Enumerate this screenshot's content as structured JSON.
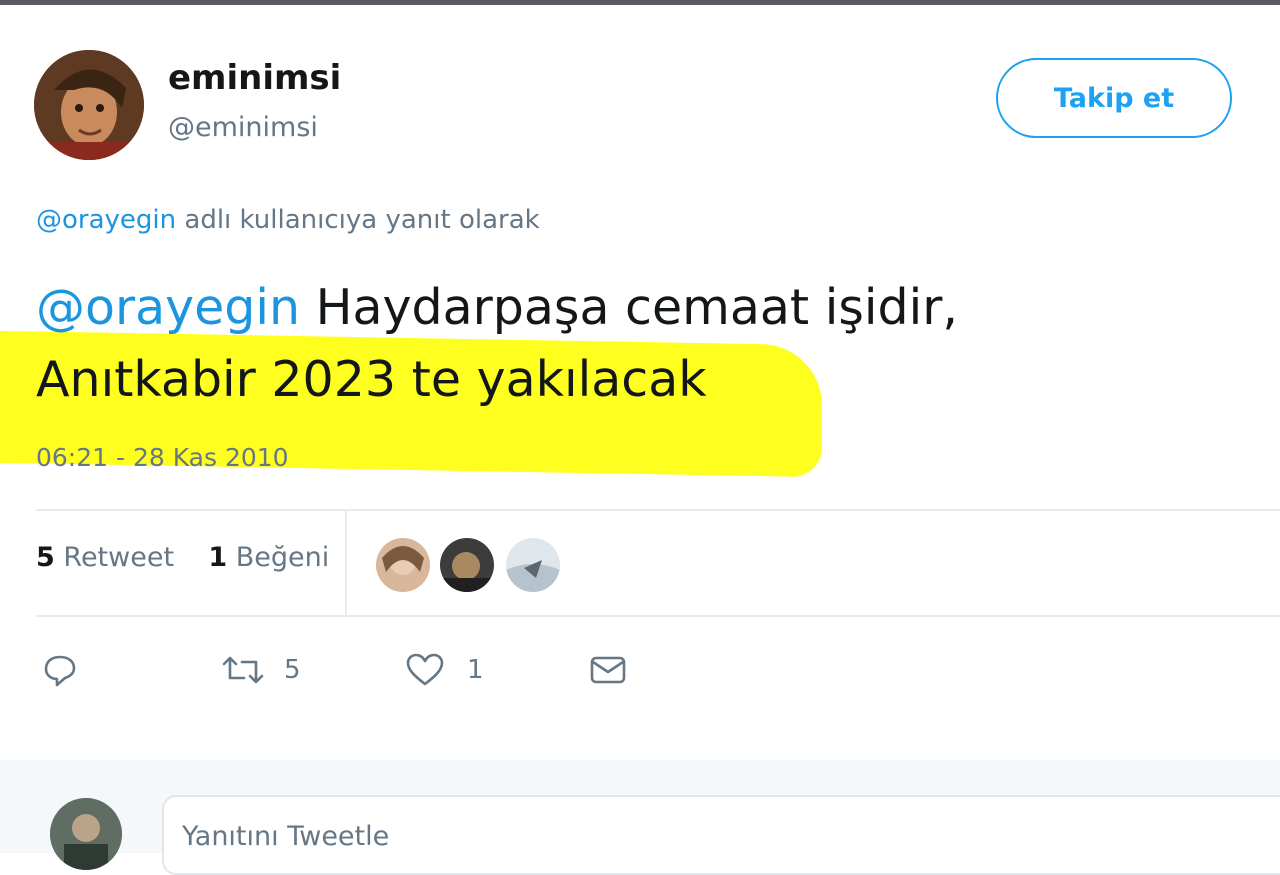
{
  "tweet": {
    "display_name": "eminimsi",
    "handle": "@eminimsi",
    "follow_label": "Takip et",
    "reply_to_mention": "@orayegin",
    "reply_to_suffix": " adlı kullanıcıya yanıt olarak",
    "text_mention": "@orayegin",
    "text_line1": " Haydarpaşa cemaat işidir,",
    "text_line2": "Anıtkabir 2023 te yakılacak",
    "timestamp": "06:21 - 28 Kas 2010",
    "highlight_color": "#ffff1f",
    "accent_color": "#1da1f2"
  },
  "stats": {
    "retweet_count": "5",
    "retweet_label": "Retweet",
    "like_count": "1",
    "like_label": "Beğeni"
  },
  "actions": {
    "reply_icon": "reply-icon",
    "retweet_icon": "retweet-icon",
    "retweet_count": "5",
    "like_icon": "heart-icon",
    "like_count": "1",
    "dm_icon": "envelope-icon"
  },
  "reply_box": {
    "placeholder": "Yanıtını Tweetle"
  }
}
